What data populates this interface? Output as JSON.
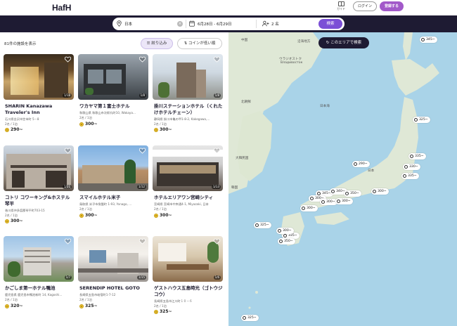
{
  "header": {
    "logo": "HafH",
    "guide_label": "ガイド",
    "login_label": "ログイン",
    "signup_label": "登録する"
  },
  "search": {
    "location": "日本",
    "dates": "6月28日 - 6月29日",
    "guests": "2 名",
    "button_label": "検索"
  },
  "list": {
    "count_text": "81件の施設を表示",
    "filter_label": "絞り込み",
    "sort_label": "コインが低い順",
    "cards": [
      {
        "title": "SHARIN Kanazawa Traveler's Inn",
        "address": "石川県金沢市笠市町 5－8",
        "capacity": "2名 / 1泊",
        "price": "290~",
        "badge": "1/18"
      },
      {
        "title": "ワカヤマ第１富士ホテル",
        "address": "和歌山県 和歌山市次郎丸町10, Wakaya...",
        "capacity": "2名 / 1泊",
        "price": "300~",
        "badge": "1/8"
      },
      {
        "title": "掛川ステーションホテル（くれたけホテルチェーン）",
        "address": "静岡県 掛川市亀の甲1-8-2, Kakegawa,...",
        "capacity": "2名 / 1泊",
        "price": "300~",
        "badge": "1/8"
      },
      {
        "title": "コトリ コワーキング&ホステル 琴平",
        "address": "香川県仲多度郡琴平町703-15",
        "capacity": "2名 / 1泊",
        "price": "300~",
        "badge": "1/21"
      },
      {
        "title": "スマイルホテル米子",
        "address": "鳥取県 米子市角盤町 1-93, Yonago, ...",
        "capacity": "2名 / 1泊",
        "price": "300~",
        "badge": "1/12"
      },
      {
        "title": "ホテルエリアワン宮崎シティ",
        "address": "宮崎県 宮崎市中央通4-1, Miyazaki, 日本",
        "capacity": "2名 / 1泊",
        "price": "300~",
        "badge": "1/13"
      },
      {
        "title": "かごしま第一ホテル鴨池",
        "address": "鹿児島県 鹿児島市鴨池新町 14, Kagoshi...",
        "capacity": "2名 / 1泊",
        "price": "320~",
        "badge": "1/7"
      },
      {
        "title": "SERENDIP HOTEL GOTO",
        "address": "長崎県五島市岐宿町1-7-12",
        "capacity": "2名 / 1泊",
        "price": "325~",
        "badge": "1/15"
      },
      {
        "title": "ゲストハウス五島時光（ゴトウジコウ）",
        "address": "長崎県五島市江川町１０－６",
        "capacity": "2名 / 1泊",
        "price": "325~",
        "badge": "1/6"
      }
    ]
  },
  "map": {
    "search_area_label": "このエリアで検索",
    "place_labels": [
      "中国",
      "韓国",
      "大韓民国",
      "日本海",
      "北朝鮮",
      "ウラジオストク",
      "Владивосток",
      "沿海地方",
      "日本"
    ],
    "pins": [
      "345~",
      "325~",
      "335~",
      "330~",
      "335~",
      "290~",
      "300~",
      "345~",
      "340~",
      "350~",
      "300~",
      "300~",
      "300~",
      "300~",
      "325~",
      "335~",
      "350~",
      "300~",
      "325~"
    ]
  },
  "colors": {
    "brand_dark": "#1e1b33",
    "accent_purple": "#7b4fd6",
    "signup_purple": "#a259c9",
    "sea": "#a9d3e8",
    "land": "#dfe8d6",
    "coin": "#f2c93b"
  }
}
